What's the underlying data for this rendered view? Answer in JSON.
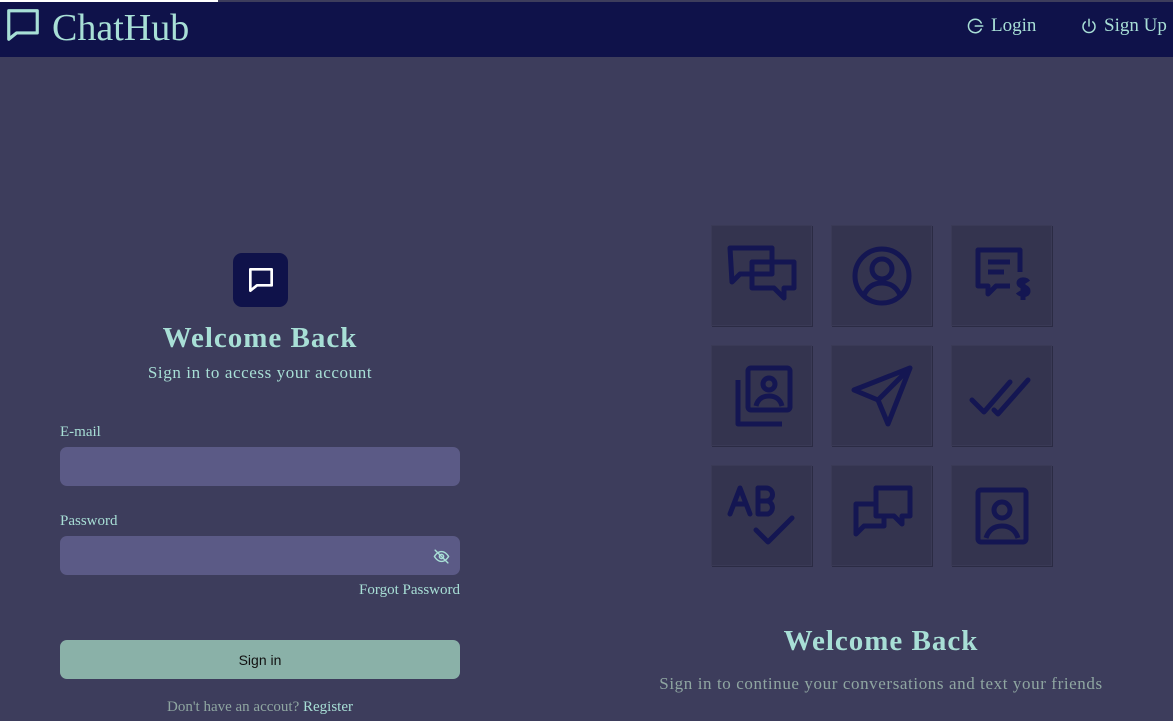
{
  "brand": {
    "name": "ChatHub",
    "icon": "chat-bubble-icon"
  },
  "nav": {
    "login": {
      "label": "Login",
      "icon": "login-icon"
    },
    "signup": {
      "label": "Sign Up",
      "icon": "power-icon"
    }
  },
  "form": {
    "icon": "chat-bubble-icon",
    "title": "Welcome Back",
    "subtitle": "Sign in to access your account",
    "email_label": "E-mail",
    "email_value": "",
    "password_label": "Password",
    "password_value": "",
    "password_toggle_icon": "eye-off-icon",
    "forgot_label": "Forgot Password",
    "signin_label": "Sign in",
    "register_prompt": "Don't have an accout?",
    "register_link": "Register"
  },
  "feature_grid": {
    "icons": [
      "chat-bubbles-icon",
      "user-circle-icon",
      "message-dollar-icon",
      "photo-stack-icon",
      "send-icon",
      "double-check-icon",
      "spellcheck-icon",
      "conversation-icon",
      "user-square-icon"
    ]
  },
  "promo": {
    "title": "Welcome Back",
    "subtitle": "Sign in to continue your conversations and text your friends"
  },
  "colors": {
    "navbar": "#0f124a",
    "background": "#3d3d5c",
    "accent_text": "#a8dfd6",
    "input_bg": "#5b5a86",
    "button_bg": "#8ab1a8",
    "tile_bg": "#34344f",
    "tile_icon": "#141652"
  }
}
